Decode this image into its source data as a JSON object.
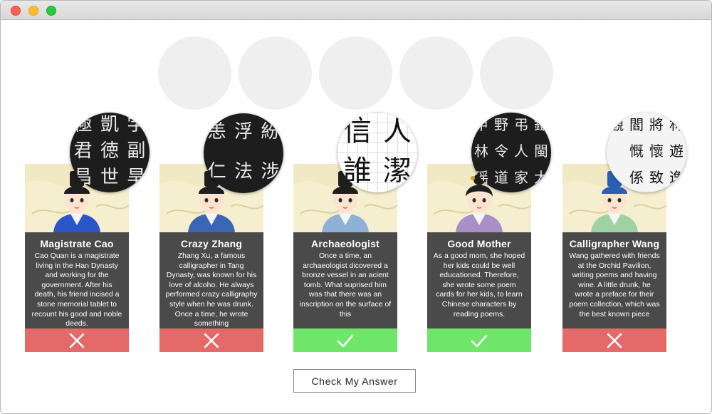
{
  "slots": [
    {},
    {},
    {},
    {},
    {}
  ],
  "cards": [
    {
      "name": "Magistrate Cao",
      "description": "Cao Quan is a magistrate living in the Han Dynasty and working for the government.  After his death, his friend incised a stone memorial tablet to recount his good and noble deeds.",
      "result": "wrong",
      "robe_color": "#2b56c7",
      "stamp": {
        "style": "dark",
        "chars": [
          "学",
          "副",
          "旱",
          "凱",
          "徳",
          "世",
          "極",
          "君",
          "昌"
        ]
      }
    },
    {
      "name": "Crazy Zhang",
      "description": "Zhang Xu, a famous calligrapher in Tang Dynasty, was known for his love of alcoho. He always performed crazy calligraphy style when he was drunk. Once a time, he wrote something",
      "result": "wrong",
      "robe_color": "#3a66b5",
      "stamp": {
        "style": "dark",
        "chars": [
          "紛",
          "涉",
          "浮",
          "法",
          "恙",
          "仁"
        ]
      }
    },
    {
      "name": "Archaeologist",
      "description": "Once a time, an archaeologist dicovered a bronze vessel in an acient tomb. What suprised him was that there was an inscription on the surface of this",
      "result": "right",
      "robe_color": "#8fb1d6",
      "stamp": {
        "style": "white",
        "chars": [
          "人",
          "潔",
          "信",
          "誰"
        ]
      }
    },
    {
      "name": "Good Mother",
      "description": "As a good mom, she hoped her kids could be well educationed. Therefore, she wrote some poem cards for her kids, to learn Chinese characters by reading poems.",
      "result": "right",
      "robe_color": "#a98ec7",
      "stamp": {
        "style": "dark",
        "chars": [
          "鐵",
          "閩",
          "大",
          "弔",
          "人",
          "家",
          "野",
          "令",
          "道",
          "甲",
          "林",
          "瑶"
        ]
      }
    },
    {
      "name": "Calligrapher Wang",
      "description": "Wang gathered with friends at the Orchid Pavilion, writing poems and having wine. A little drunk, he wrote a preface for their poem collection, which was the best known piece",
      "result": "wrong",
      "robe_color": "#9fd1a3",
      "stamp": {
        "style": "light",
        "chars": [
          "林",
          "遊",
          "逸",
          "將",
          "懷",
          "致",
          "閻",
          "慨",
          "係",
          "觀"
        ]
      }
    }
  ],
  "check_button_label": "Check My Answer"
}
